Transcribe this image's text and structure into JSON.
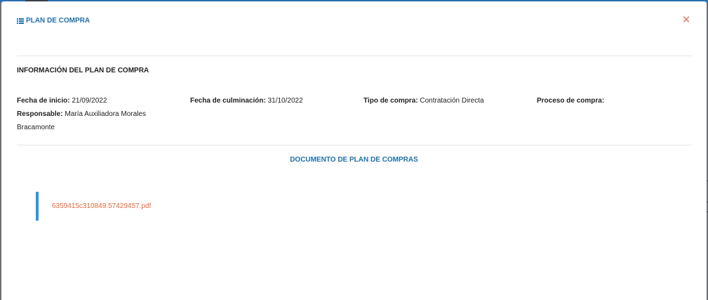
{
  "modal": {
    "title": "PLAN DE COMPRA",
    "title_icon": "list-icon",
    "close_icon": "close-icon",
    "close_glyph": "✕"
  },
  "info": {
    "heading": "INFORMACIÓN DEL PLAN DE COMPRA",
    "fecha_inicio_label": "Fecha de inicio:",
    "fecha_inicio_value": "21/09/2022",
    "fecha_culminacion_label": "Fecha de culminación:",
    "fecha_culminacion_value": "31/10/2022",
    "tipo_compra_label": "Tipo de compra:",
    "tipo_compra_value": "Contratación Directa",
    "proceso_compra_label": "Proceso de compra:",
    "proceso_compra_value": "",
    "responsable_label": "Responsable:",
    "responsable_value_line1": "María Auxiliadora Morales",
    "responsable_value_line2": "Bracamonte"
  },
  "documents": {
    "heading": "DOCUMENTO DE PLAN DE COMPRAS",
    "files": [
      {
        "name": "6359415c310849.57429457.pdf"
      }
    ]
  },
  "colors": {
    "accent_blue": "#1f6fa8",
    "file_bar_blue": "#2f96df",
    "file_link_orange": "#e8693b",
    "close_red": "#e9776a"
  }
}
